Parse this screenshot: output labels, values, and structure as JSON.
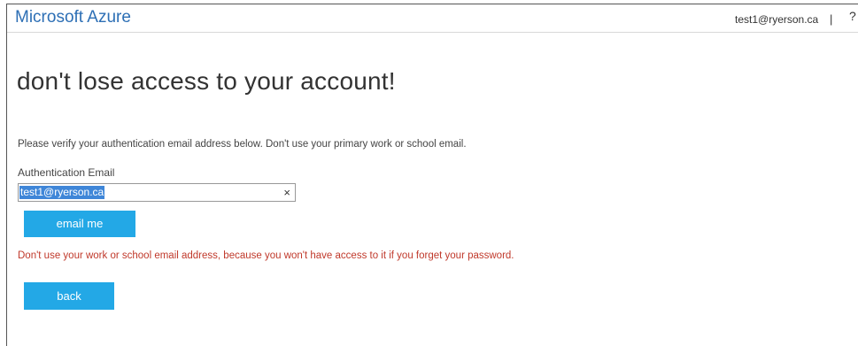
{
  "header": {
    "brand": "Microsoft Azure",
    "user_email": "test1@ryerson.ca",
    "separator": "|",
    "help_label": "?"
  },
  "page": {
    "title": "don't lose access to your account!",
    "instruction": "Please verify your authentication email address below. Don't use your primary work or school email.",
    "field_label": "Authentication Email",
    "email_value": "test1@ryerson.ca",
    "clear_glyph": "×",
    "email_button_label": "email me",
    "warning": "Don't use your work or school email address, because you won't have access to it if you forget your password.",
    "back_button_label": "back"
  },
  "colors": {
    "brand": "#2d6fb5",
    "button": "#23a8e6",
    "warning": "#c0392b",
    "selection": "#3f86d8"
  },
  "icons": {
    "clear": "close-icon"
  }
}
